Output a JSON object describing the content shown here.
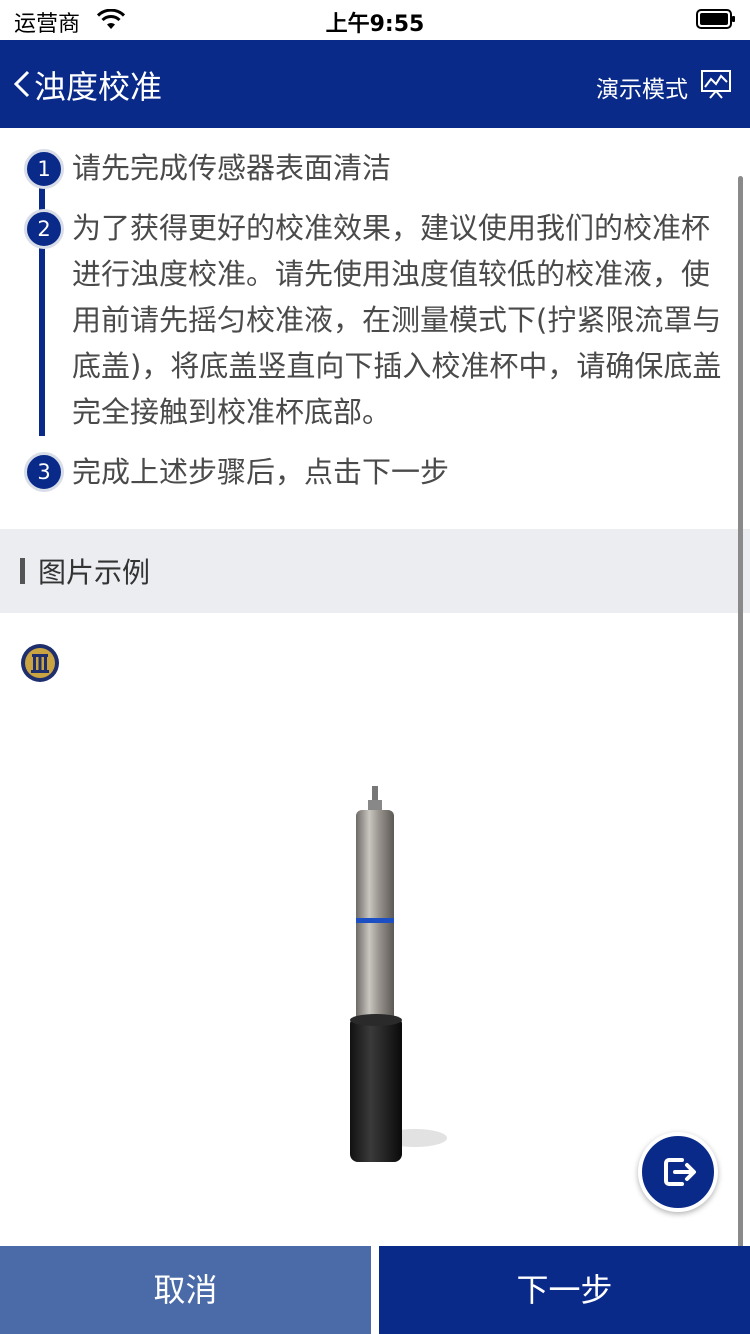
{
  "status_bar": {
    "carrier": "运营商",
    "time": "上午9:55"
  },
  "nav": {
    "title": "浊度校准",
    "demo_label": "演示模式"
  },
  "steps": [
    {
      "num": "1",
      "text": "请先完成传感器表面清洁"
    },
    {
      "num": "2",
      "text": "为了获得更好的校准效果，建议使用我们的校准杯进行浊度校准。请先使用浊度值较低的校准液，使用前请先摇匀校准液，在测量模式下(拧紧限流罩与底盖)，将底盖竖直向下插入校准杯中，请确保底盖完全接触到校准杯底部。"
    },
    {
      "num": "3",
      "text": "完成上述步骤后，点击下一步"
    }
  ],
  "section": {
    "title": "图片示例"
  },
  "buttons": {
    "cancel": "取消",
    "next": "下一步"
  },
  "colors": {
    "primary": "#0a2a8a",
    "cancel": "#4a6aa8",
    "section_bg": "#ebedf0"
  }
}
